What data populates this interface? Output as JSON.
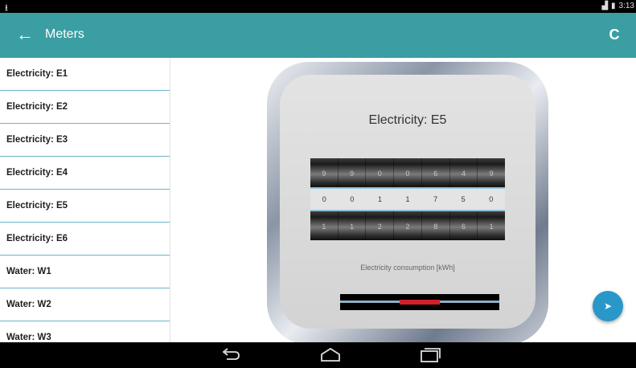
{
  "status_bar": {
    "time": "3:13"
  },
  "app_bar": {
    "title": "Meters"
  },
  "sidebar": {
    "items": [
      {
        "label": "Electricity: E1"
      },
      {
        "label": "Electricity: E2"
      },
      {
        "label": "Electricity: E3"
      },
      {
        "label": "Electricity: E4"
      },
      {
        "label": "Electricity: E5"
      },
      {
        "label": "Electricity: E6"
      },
      {
        "label": "Water: W1"
      },
      {
        "label": "Water: W2"
      },
      {
        "label": "Water: W3"
      }
    ]
  },
  "meter": {
    "title": "Electricity: E5",
    "drum_top": [
      "9",
      "9",
      "0",
      "0",
      "6",
      "4",
      "9"
    ],
    "digits": [
      "0",
      "0",
      "1",
      "1",
      "7",
      "5",
      "0"
    ],
    "drum_bottom": [
      "1",
      "1",
      "2",
      "2",
      "8",
      "6",
      "1"
    ],
    "consumption_label": "Electricity consumption  [kWh]"
  },
  "colors": {
    "app_bar": "#3a9ea3",
    "list_divider": "#6bb3c7",
    "fab": "#2a97c9",
    "indicator_red": "#d2202b"
  },
  "icons": {
    "back": "arrow-left-icon",
    "refresh": "refresh-icon",
    "fab": "send-icon",
    "nav_back": "nav-back-icon",
    "nav_home": "nav-home-icon",
    "nav_recents": "nav-recents-icon"
  }
}
